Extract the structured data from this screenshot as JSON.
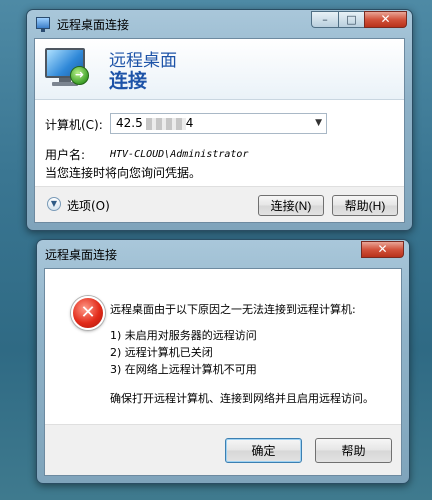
{
  "window1": {
    "title": "远程桌面连接",
    "banner_line1": "远程桌面",
    "banner_line2": "连接",
    "computer_label": "计算机(C):",
    "computer_value": "42.5",
    "computer_value_tail": "4",
    "username_label": "用户名:",
    "username_value": "HTV-CLOUD\\Administrator",
    "notice": "当您连接时将向您询问凭据。",
    "options_label": "选项(O)",
    "connect_button": "连接(N)",
    "help_button": "帮助(H)"
  },
  "window2": {
    "title": "远程桌面连接",
    "message": "远程桌面由于以下原因之一无法连接到远程计算机:",
    "reasons": [
      "1) 未启用对服务器的远程访问",
      "2) 远程计算机已关闭",
      "3) 在网络上远程计算机不可用"
    ],
    "instruction": "确保打开远程计算机、连接到网络并且启用远程访问。",
    "ok_button": "确定",
    "help_button": "帮助"
  },
  "icons": {
    "app": "remote-desktop-icon",
    "error": "error-icon"
  },
  "colors": {
    "banner_text": "#1d53a8",
    "error_red": "#e22b1a"
  }
}
